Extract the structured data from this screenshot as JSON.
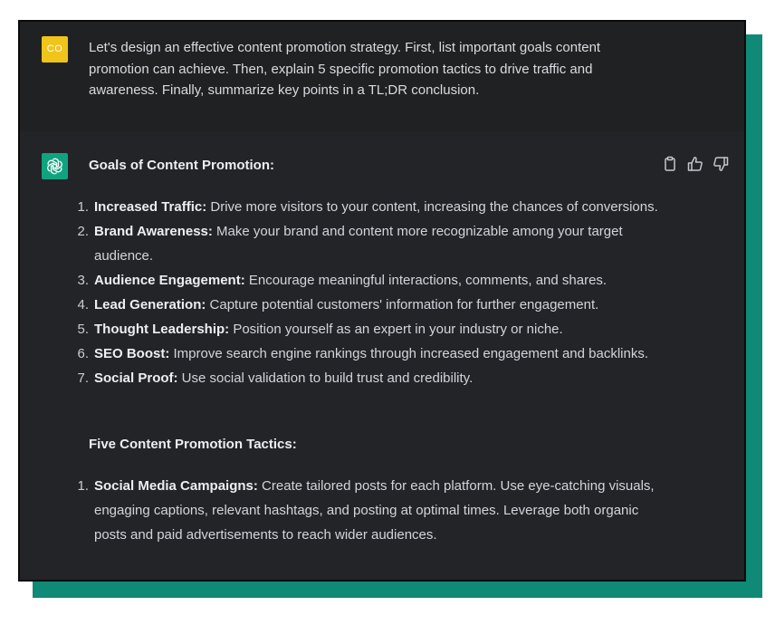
{
  "colors": {
    "page_background": "#ffffff",
    "shadow_teal": "#0f8a76",
    "user_row": "#202123",
    "assistant_row": "#232427",
    "user_avatar": "#f0c419",
    "assistant_avatar": "#10a37f",
    "text": "#d1d5db"
  },
  "user_message": {
    "avatar_initials": "CO",
    "text": "Let's design an effective content promotion strategy. First, list important goals content promotion can achieve. Then, explain 5 specific promotion tactics to drive traffic and awareness. Finally, summarize key points in a TL;DR conclusion."
  },
  "assistant_message": {
    "avatar_icon": "openai-logo-icon",
    "action_icons": [
      "clipboard-icon",
      "thumbs-up-icon",
      "thumbs-down-icon"
    ],
    "goals_heading": "Goals of Content Promotion:",
    "goals": [
      {
        "num": "1.",
        "term": "Increased Traffic:",
        "text": " Drive more visitors to your content, increasing the chances of conversions."
      },
      {
        "num": "2.",
        "term": "Brand Awareness:",
        "text": " Make your brand and content more recognizable among your target audience."
      },
      {
        "num": "3.",
        "term": "Audience Engagement:",
        "text": " Encourage meaningful interactions, comments, and shares."
      },
      {
        "num": "4.",
        "term": "Lead Generation:",
        "text": " Capture potential customers' information for further engagement."
      },
      {
        "num": "5.",
        "term": "Thought Leadership:",
        "text": " Position yourself as an expert in your industry or niche."
      },
      {
        "num": "6.",
        "term": "SEO Boost:",
        "text": " Improve search engine rankings through increased engagement and backlinks."
      },
      {
        "num": "7.",
        "term": "Social Proof:",
        "text": " Use social validation to build trust and credibility."
      }
    ],
    "tactics_heading": "Five Content Promotion Tactics:",
    "tactics": [
      {
        "num": "1.",
        "term": "Social Media Campaigns:",
        "text": " Create tailored posts for each platform. Use eye-catching visuals, engaging captions, relevant hashtags, and posting at optimal times. Leverage both organic posts and paid advertisements to reach wider audiences."
      }
    ]
  }
}
